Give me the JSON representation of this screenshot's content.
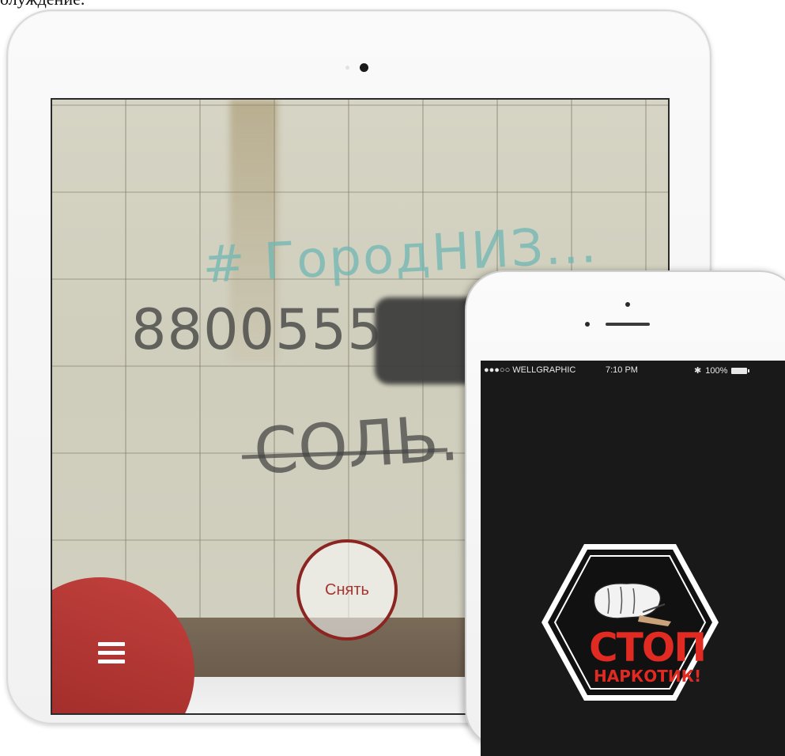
{
  "caption": "олуждение.",
  "ipad": {
    "photo": {
      "graffiti_hashtag": "# ГородНИЗ...",
      "graffiti_phone": "8800555",
      "graffiti_sign": "СОЛЬ.",
      "capture_button_label": "Снять"
    },
    "menu_icon": "hamburger-icon"
  },
  "iphone": {
    "status_bar": {
      "carrier": "●●●○○ WELLGRAPHIC",
      "time": "7:10 PM",
      "battery": "100%"
    },
    "logo": {
      "line1": "СТОП",
      "line2": "НАРКОТИК!"
    }
  },
  "colors": {
    "accent_red": "#a52f2c",
    "capture_ring": "#8c2522",
    "phone_screen_bg": "#1a1919"
  }
}
